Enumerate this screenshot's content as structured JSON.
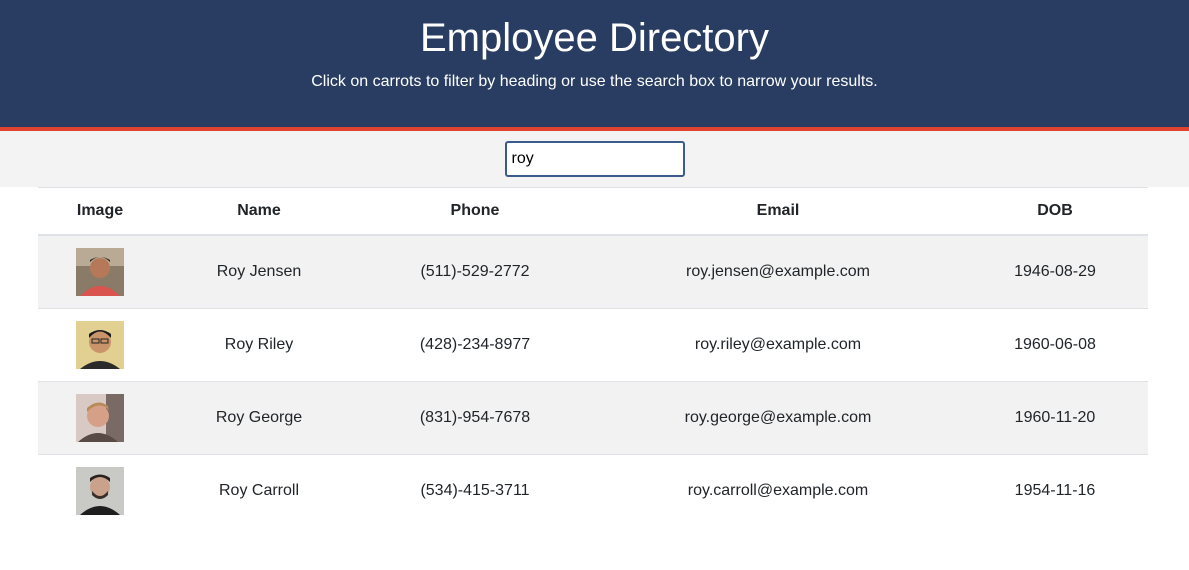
{
  "header": {
    "title": "Employee Directory",
    "subtitle": "Click on carrots to filter by heading or use the search box to narrow your results."
  },
  "search": {
    "value": "roy"
  },
  "table": {
    "columns": {
      "image": "Image",
      "name": "Name",
      "phone": "Phone",
      "email": "Email",
      "dob": "DOB"
    },
    "rows": [
      {
        "name": "Roy Jensen",
        "phone": "(511)-529-2772",
        "email": "roy.jensen@example.com",
        "dob": "1946-08-29"
      },
      {
        "name": "Roy Riley",
        "phone": "(428)-234-8977",
        "email": "roy.riley@example.com",
        "dob": "1960-06-08"
      },
      {
        "name": "Roy George",
        "phone": "(831)-954-7678",
        "email": "roy.george@example.com",
        "dob": "1960-11-20"
      },
      {
        "name": "Roy Carroll",
        "phone": "(534)-415-3711",
        "email": "roy.carroll@example.com",
        "dob": "1954-11-16"
      }
    ]
  },
  "colors": {
    "header_bg": "#293d62",
    "header_accent": "#e0432f",
    "search_border": "#3b5b8c",
    "row_stripe": "#f2f2f2"
  }
}
